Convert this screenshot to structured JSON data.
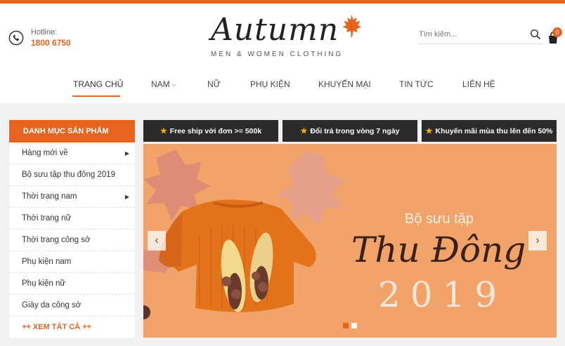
{
  "header": {
    "hotline_label": "Hotline:",
    "hotline_number": "1800 6750",
    "logo_word": "Autumn",
    "logo_tagline": "MEN & WOMEN CLOTHING",
    "search_placeholder": "Tìm kiếm...",
    "cart_count": "0"
  },
  "nav": {
    "items": [
      {
        "label": "TRANG CHỦ"
      },
      {
        "label": "NAM"
      },
      {
        "label": "NỮ"
      },
      {
        "label": "PHỤ KIỆN"
      },
      {
        "label": "KHUYẾN MẠI"
      },
      {
        "label": "TIN TỨC"
      },
      {
        "label": "LIÊN HỆ"
      }
    ]
  },
  "sidebar": {
    "title": "DANH MỤC SẢN PHẨM",
    "items": [
      {
        "label": "Hàng mới về"
      },
      {
        "label": "Bộ sưu tập thu đông 2019"
      },
      {
        "label": "Thời trang nam"
      },
      {
        "label": "Thời trang nữ"
      },
      {
        "label": "Thời trang công sở"
      },
      {
        "label": "Phụ kiện nam"
      },
      {
        "label": "Phụ kiện nữ"
      },
      {
        "label": "Giày da công sở"
      }
    ],
    "more": "++ XEM TẤT CẢ ++"
  },
  "promos": [
    {
      "label": "Free ship với đơn >= 500k"
    },
    {
      "label": "Đổi trả trong vòng 7 ngày"
    },
    {
      "label": "Khuyến mãi mùa thu lên đến 50%"
    }
  ],
  "banner": {
    "small_text": "Bộ sưu tập",
    "big_text": "Thu Đông",
    "year_text": "2019"
  },
  "colors": {
    "accent": "#e8641e",
    "promo_bg": "#2b2b2b",
    "banner_bg": "#f1a36a"
  }
}
